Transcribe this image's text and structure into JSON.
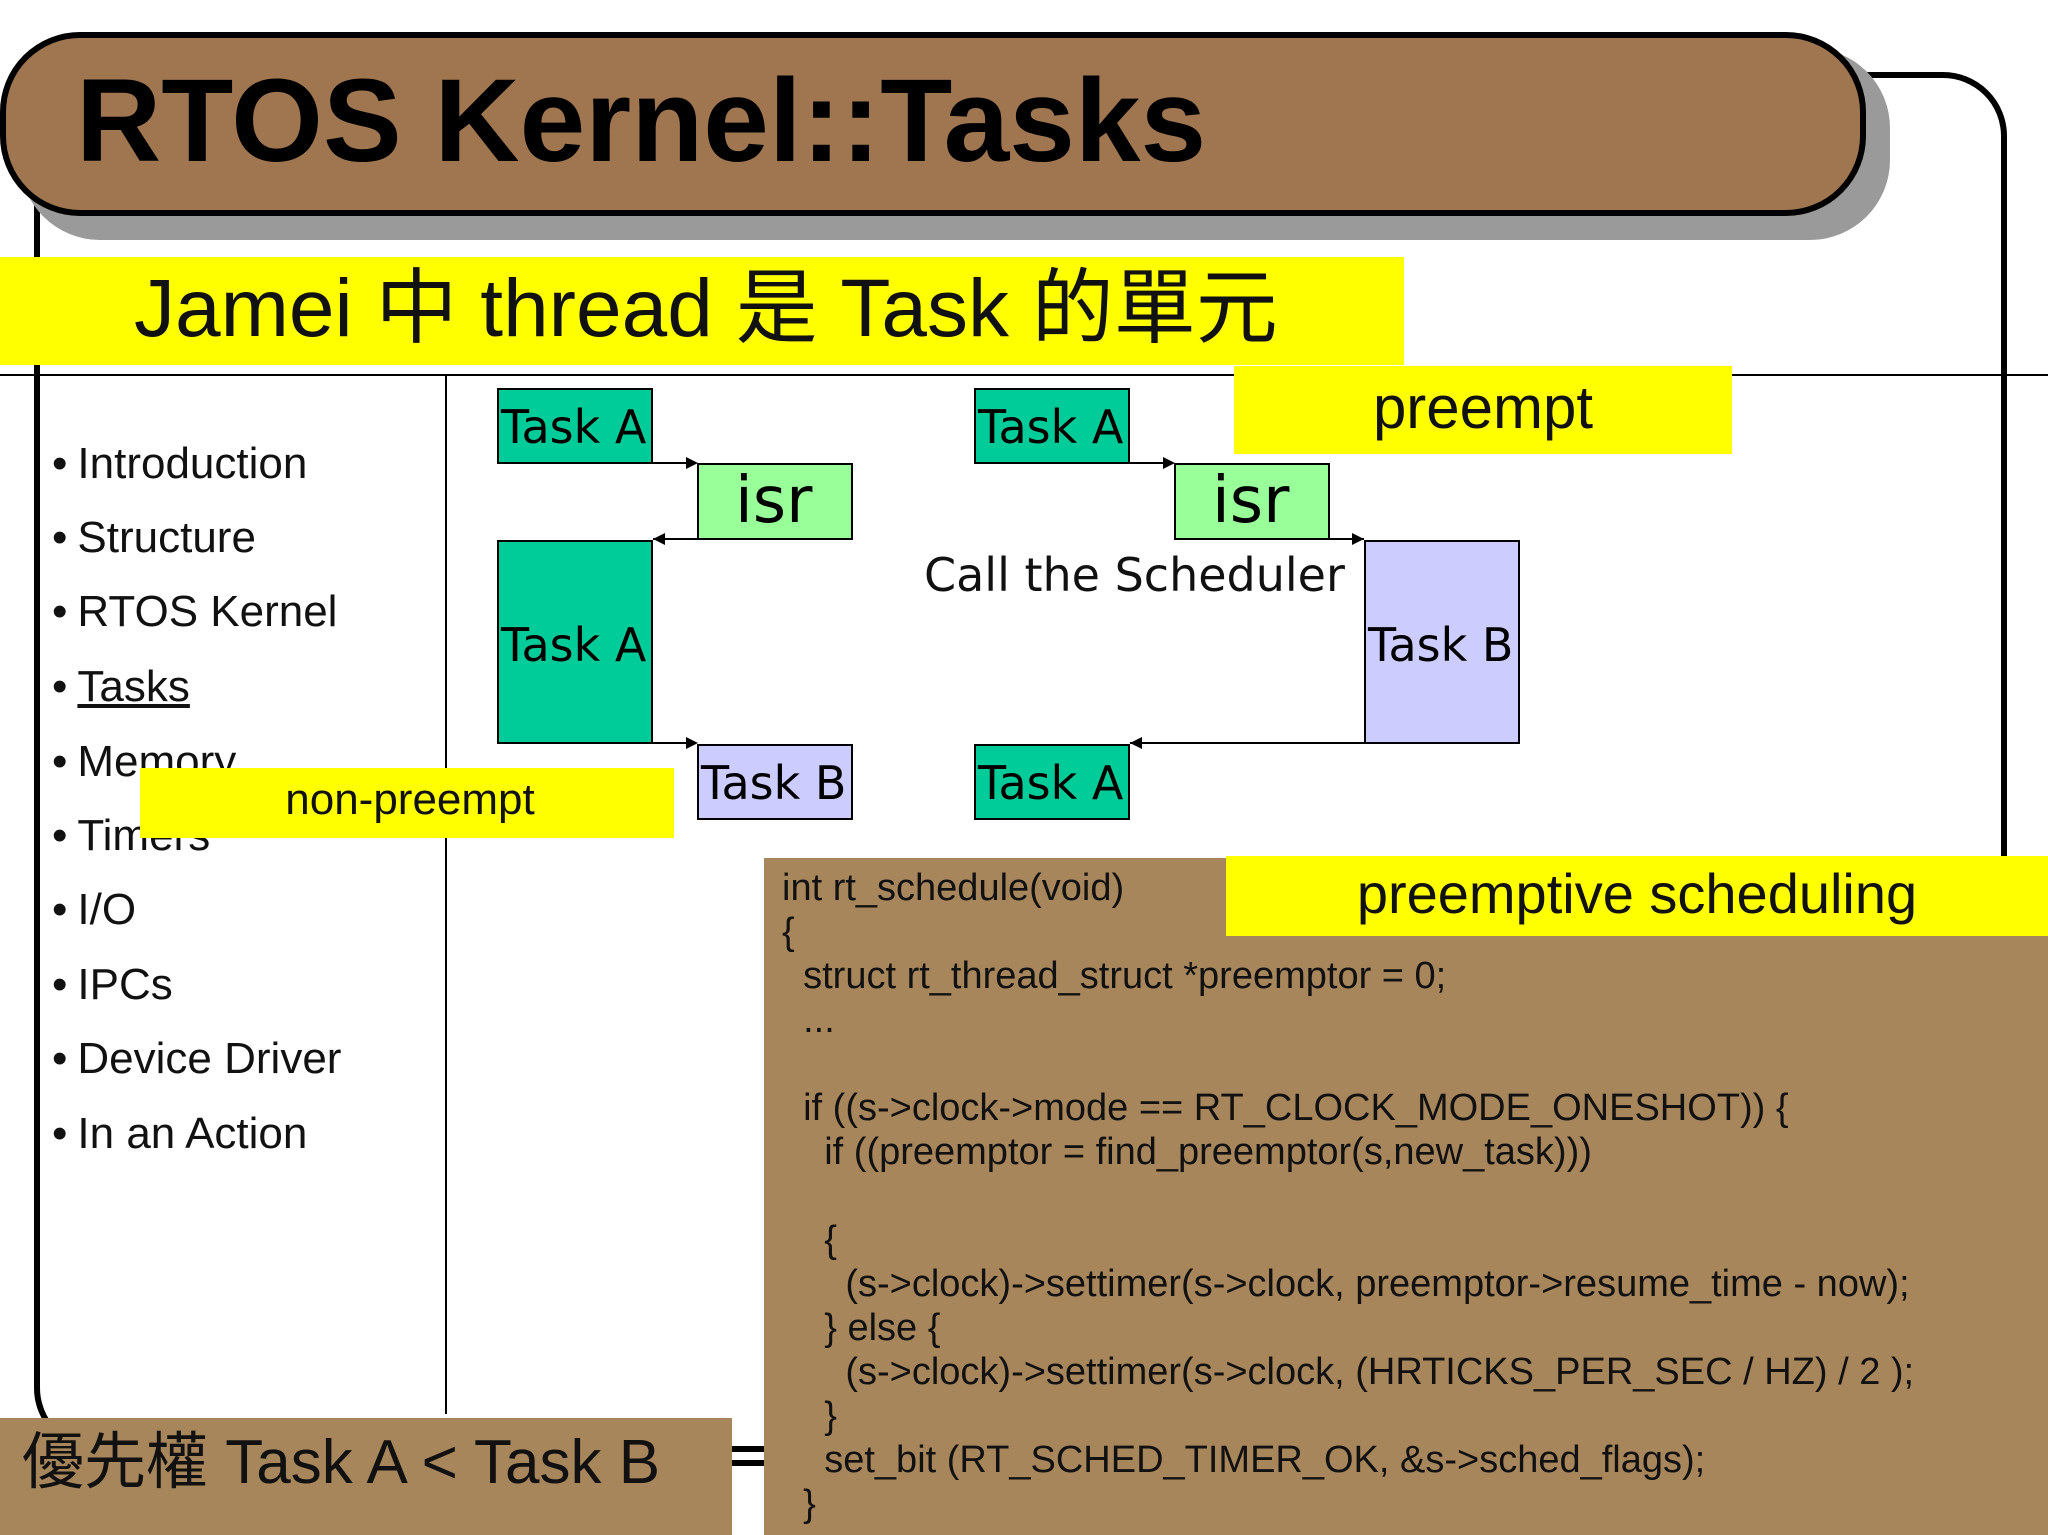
{
  "title": "RTOS Kernel::Tasks",
  "subtitle": "Jamei 中 thread 是 Task 的單元",
  "nav": {
    "items": [
      {
        "label": "Introduction"
      },
      {
        "label": "Structure"
      },
      {
        "label": "RTOS Kernel"
      },
      {
        "label": "Tasks"
      },
      {
        "label": "Memory"
      },
      {
        "label": "Timers"
      },
      {
        "label": "I/O"
      },
      {
        "label": "IPCs"
      },
      {
        "label": "Device Driver"
      },
      {
        "label": "In an Action"
      }
    ],
    "bullet": "•"
  },
  "banners": {
    "non_preempt": "non-preempt",
    "preempt": "preempt",
    "preemptive_scheduling": "preemptive scheduling"
  },
  "diagram": {
    "left": {
      "task_a_top": "Task A",
      "isr": "isr",
      "task_a_mid": "Task A",
      "task_b": "Task B"
    },
    "right": {
      "task_a_top": "Task A",
      "isr": "isr",
      "call_label": "Call the Scheduler",
      "task_b": "Task B",
      "task_a_bottom": "Task A"
    }
  },
  "code": "int rt_schedule(void)\n{\n  struct rt_thread_struct *preemptor = 0;\n  ...\n\n  if ((s->clock->mode == RT_CLOCK_MODE_ONESHOT)) {\n    if ((preemptor = find_preemptor(s,new_task)))\n\n    {\n      (s->clock)->settimer(s->clock, preemptor->resume_time - now);\n    } else {\n      (s->clock)->settimer(s->clock, (HRTICKS_PER_SEC / HZ) / 2 );\n    }\n    set_bit (RT_SCHED_TIMER_OK, &s->sched_flags);\n  }",
  "priority": "優先權 Task A < Task B",
  "colors": {
    "title_bar": "#a07650",
    "banner_yellow": "#ffff00",
    "task_a": "#00cc99",
    "task_b": "#ccccff",
    "isr": "#99ff99",
    "code_bg": "#a8865c"
  }
}
